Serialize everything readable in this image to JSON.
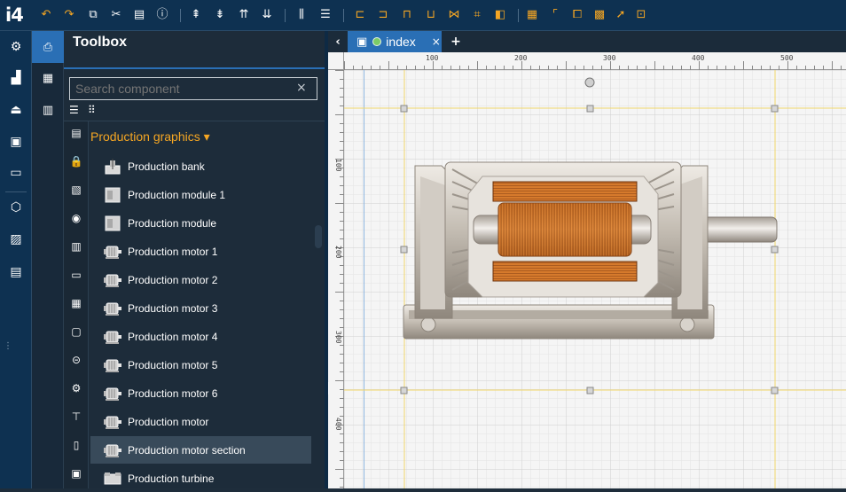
{
  "app": {
    "logo": "i4"
  },
  "toolbar": {
    "buttons": [
      "undo-icon",
      "redo-icon",
      "copy-icon",
      "cut-icon",
      "paste-icon",
      "info-icon",
      "align-top-icon",
      "align-bottom-icon",
      "align-top-alt-icon",
      "align-bottom-alt-icon",
      "distribute-h-icon",
      "distribute-v-icon",
      "align-left-icon",
      "align-right-icon",
      "align-top-edge-icon",
      "align-bottom-edge-icon",
      "center-h-icon",
      "center-v-icon",
      "bring-front-icon",
      "grid-icon",
      "snap-icon",
      "group-icon",
      "table-icon",
      "select-icon",
      "frame-icon"
    ]
  },
  "rail": {
    "items": [
      "settings-icon",
      "chart-icon",
      "tray-icon",
      "screen-icon",
      "monitor-icon",
      "box-icon",
      "analytics-icon",
      "archive-icon"
    ]
  },
  "toolbox": {
    "title": "Toolbox",
    "search_placeholder": "Search component",
    "clear": "×",
    "group": "Production graphics",
    "group_caret": "▾",
    "items": [
      {
        "label": "Production bank",
        "icon": "bank-icon"
      },
      {
        "label": "Production module 1",
        "icon": "module-icon"
      },
      {
        "label": "Production module",
        "icon": "module-icon"
      },
      {
        "label": "Production motor 1",
        "icon": "motor-icon"
      },
      {
        "label": "Production motor 2",
        "icon": "motor-icon"
      },
      {
        "label": "Production motor 3",
        "icon": "motor-icon"
      },
      {
        "label": "Production motor 4",
        "icon": "motor-icon"
      },
      {
        "label": "Production motor 5",
        "icon": "motor-icon"
      },
      {
        "label": "Production motor 6",
        "icon": "motor-icon"
      },
      {
        "label": "Production motor",
        "icon": "motor-icon"
      },
      {
        "label": "Production motor section",
        "icon": "motor-icon"
      },
      {
        "label": "Production turbine",
        "icon": "turbine-icon"
      }
    ],
    "selected_index": 10
  },
  "tabs": {
    "prev": "‹",
    "active": {
      "label": "index",
      "close": "×",
      "status_color": "#7ccb67"
    },
    "add": "+"
  },
  "ruler": {
    "h_labels": [
      "100",
      "200",
      "300",
      "400",
      "500"
    ],
    "v_labels": [
      "100",
      "200",
      "300",
      "400"
    ]
  },
  "colors": {
    "accent": "#2a6fb5",
    "highlight": "#f5a623",
    "topbar": "#0e3151"
  }
}
